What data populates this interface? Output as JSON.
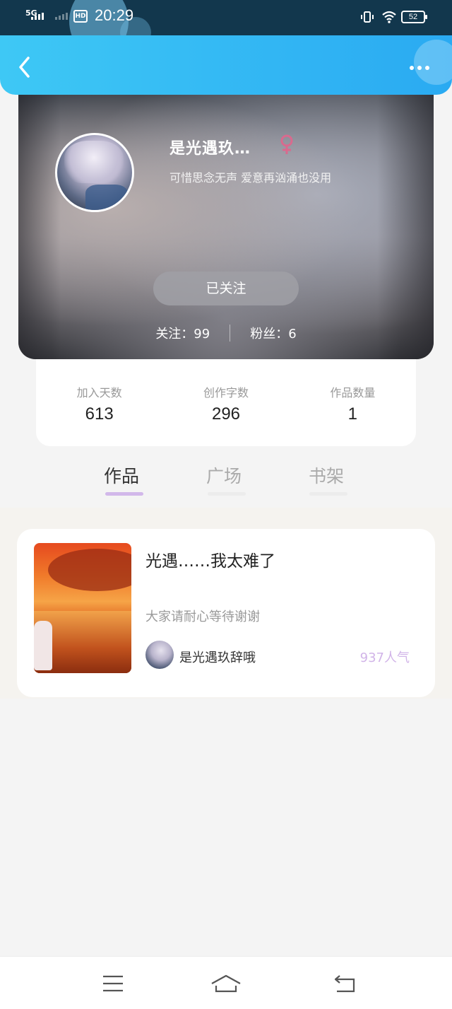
{
  "status_bar": {
    "network": "5G",
    "hd": "HD",
    "time": "20:29",
    "battery": "52"
  },
  "header": {
    "back_icon": "chevron-left-icon",
    "more_icon": "more-horizontal-icon"
  },
  "profile": {
    "name": "是光遇玖…",
    "gender_icon": "female-icon",
    "signature": "可惜思念无声 爱意再汹涌也没用",
    "follow_button": "已关注",
    "following": "关注：99",
    "followers": "粉丝：6"
  },
  "stats": [
    {
      "label": "加入天数",
      "value": "613"
    },
    {
      "label": "创作字数",
      "value": "296"
    },
    {
      "label": "作品数量",
      "value": "1"
    }
  ],
  "tabs": [
    {
      "label": "作品",
      "active": true
    },
    {
      "label": "广场",
      "active": false
    },
    {
      "label": "书架",
      "active": false
    }
  ],
  "works": [
    {
      "title": "光遇……我太难了",
      "description": "大家请耐心等待谢谢",
      "author": "是光遇玖辞哦",
      "popularity": "937人气"
    }
  ],
  "nav": {
    "menu_icon": "menu-icon",
    "home_icon": "home-icon",
    "back_icon": "return-icon"
  },
  "colors": {
    "header_start": "#3ec8f5",
    "header_end": "#2aaaf2",
    "accent": "#d2b8ea",
    "popularity": "#d1b4e8"
  }
}
